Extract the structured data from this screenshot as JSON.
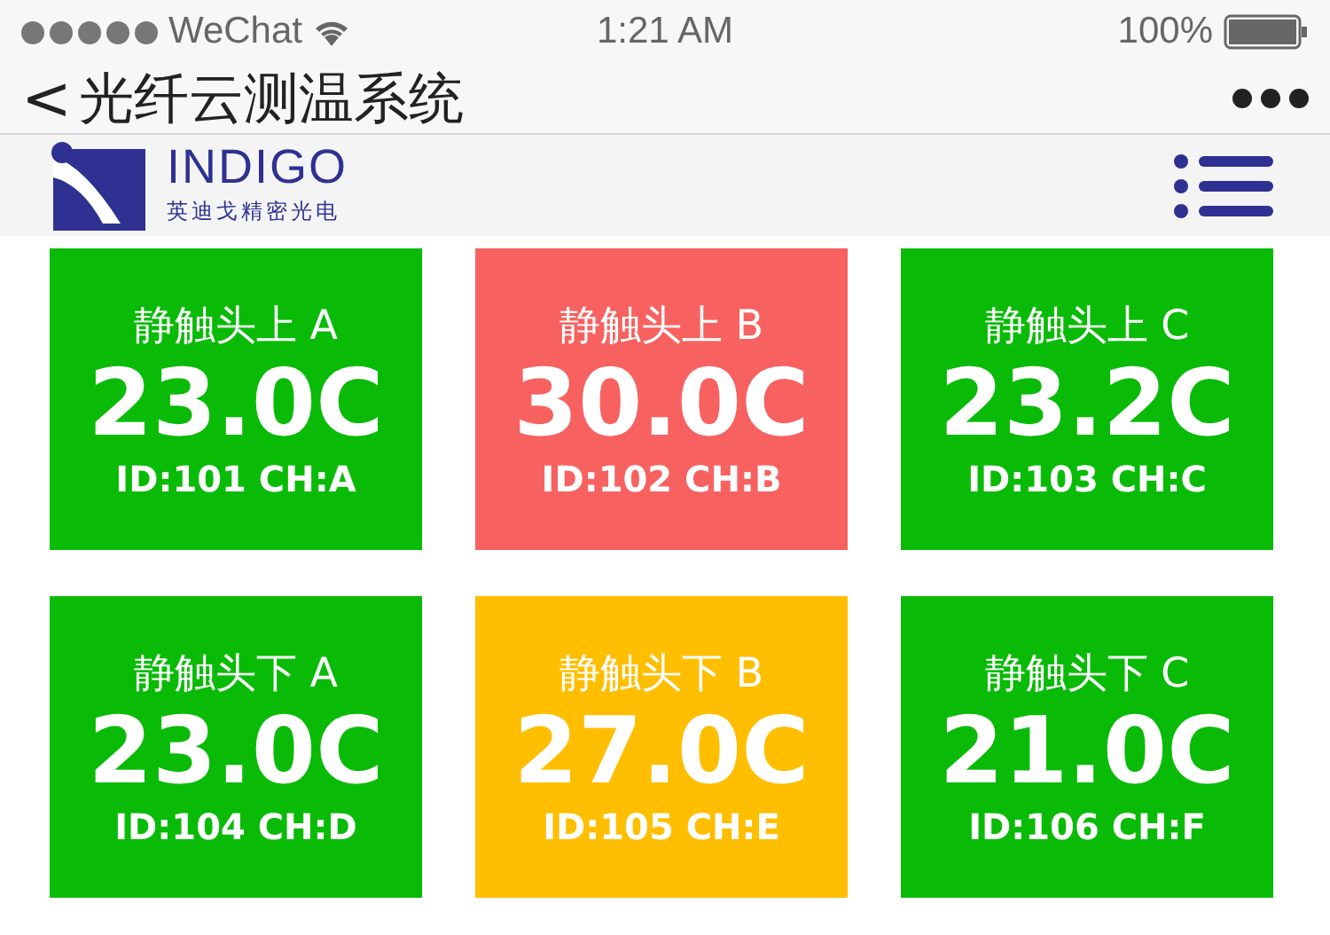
{
  "status_bar": {
    "carrier": "WeChat",
    "time": "1:21 AM",
    "battery": "100%"
  },
  "nav": {
    "back": "<",
    "title": "光纤云测温系统"
  },
  "brand": {
    "name": "INDIGO",
    "subtitle": "英迪戈精密光电"
  },
  "sensors": [
    {
      "name": "静触头上 A",
      "temperature": "23.0C",
      "info": "ID:101 CH:A",
      "color": "#09bb07"
    },
    {
      "name": "静触头上 B",
      "temperature": "30.0C",
      "info": "ID:102 CH:B",
      "color": "#f76260"
    },
    {
      "name": "静触头上 C",
      "temperature": "23.2C",
      "info": "ID:103 CH:C",
      "color": "#09bb07"
    },
    {
      "name": "静触头下 A",
      "temperature": "23.0C",
      "info": "ID:104 CH:D",
      "color": "#09bb07"
    },
    {
      "name": "静触头下 B",
      "temperature": "27.0C",
      "info": "ID:105 CH:E",
      "color": "#ffbe00"
    },
    {
      "name": "静触头下 C",
      "temperature": "21.0C",
      "info": "ID:106 CH:F",
      "color": "#09bb07"
    }
  ]
}
